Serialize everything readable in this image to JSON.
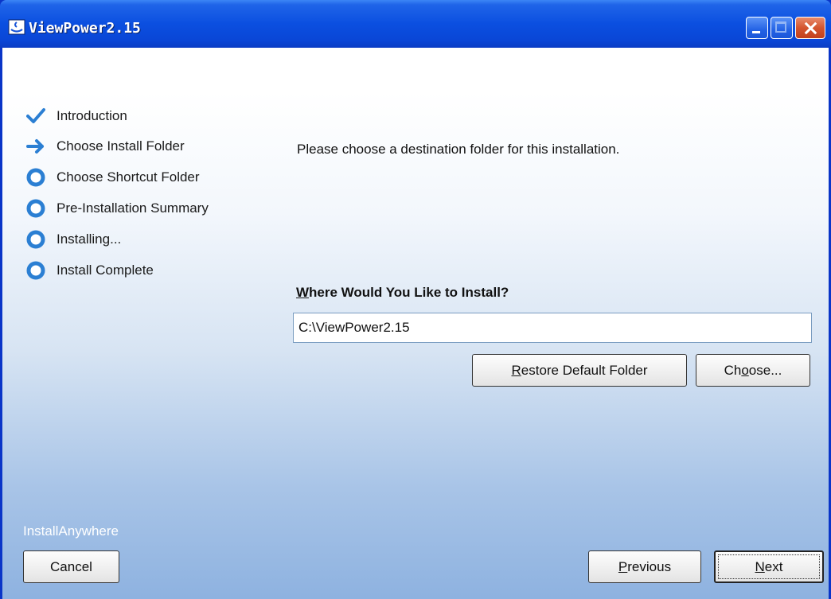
{
  "window": {
    "title": "ViewPower2.15"
  },
  "steps": [
    {
      "label": "Introduction",
      "icon": "checkmark-icon",
      "state": "done"
    },
    {
      "label": "Choose Install Folder",
      "icon": "arrow-right-icon",
      "state": "current"
    },
    {
      "label": "Choose Shortcut Folder",
      "icon": "circle-bullet-icon",
      "state": "pending"
    },
    {
      "label": "Pre-Installation Summary",
      "icon": "circle-bullet-icon",
      "state": "pending"
    },
    {
      "label": "Installing...",
      "icon": "circle-bullet-icon",
      "state": "pending"
    },
    {
      "label": "Install Complete",
      "icon": "circle-bullet-icon",
      "state": "pending"
    }
  ],
  "content": {
    "instruction": "Please choose a destination folder for this installation.",
    "where_label": {
      "mnemonic": "W",
      "rest": "here Would You Like to Install?"
    },
    "install_path": "C:\\ViewPower2.15",
    "restore_button": {
      "mnemonic": "R",
      "rest": "estore Default Folder"
    },
    "choose_button": {
      "pre": "Ch",
      "mnemonic": "o",
      "rest": "ose..."
    }
  },
  "footer": {
    "brand": "InstallAnywhere",
    "cancel_label": "Cancel",
    "previous_button": {
      "mnemonic": "P",
      "rest": "revious"
    },
    "next_button": {
      "mnemonic": "N",
      "rest": "ext"
    }
  },
  "colors": {
    "titlebar": "#0b4fe0",
    "step_icon": "#2b7fd3",
    "close_button": "#d4552f"
  }
}
